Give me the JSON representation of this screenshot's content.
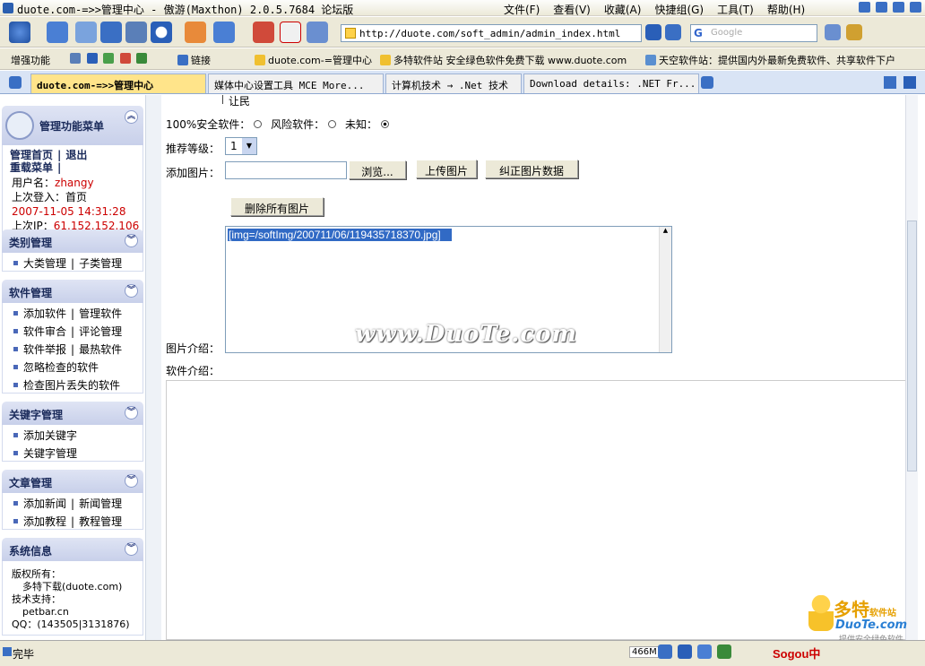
{
  "window": {
    "title": "duote.com-=>>管理中心 - 傲游(Maxthon) 2.0.5.7684 论坛版",
    "menu": [
      "文件(F)",
      "查看(V)",
      "收藏(A)",
      "快捷组(G)",
      "工具(T)",
      "帮助(H)"
    ]
  },
  "toolbar": {
    "address": "http://duote.com/soft_admin/admin_index.html",
    "search_placeholder": "Google"
  },
  "linkbar": {
    "items": [
      "增强功能",
      "链接",
      "duote.com-=管理中心",
      "多特软件站 安全绿色软件免费下载 www.duote.com",
      "天空软件站：提供国内外最新免费软件、共享软件下户"
    ]
  },
  "tabs": [
    "duote.com-=>>管理中心",
    "媒体中心设置工具 MCE More...",
    "计算机技术 → .Net 技术",
    "Download details: .NET Fr..."
  ],
  "sidebar": {
    "main": {
      "title": "管理功能菜单",
      "home": "管理首页",
      "logout": "退出",
      "reload": "重载菜单",
      "username_label": "用户名：",
      "username": "zhangy",
      "last_login_label": "上次登入：",
      "last_login_page": "首页",
      "last_login_time": "2007-11-05 14:31:28",
      "last_ip_label": "上次IP：",
      "last_ip": "61.152.152.106"
    },
    "category": {
      "title": "类别管理",
      "a": "大类管理",
      "b": "子类管理"
    },
    "software": {
      "title": "软件管理",
      "add": "添加软件",
      "manage": "管理软件",
      "review": "软件审合",
      "comments": "评论管理",
      "report": "软件举报",
      "hot": "最热软件",
      "ignored": "忽略检查的软件",
      "missing_pics": "检查图片丢失的软件"
    },
    "keywords": {
      "title": "关键字管理",
      "add": "添加关键字",
      "manage": "关键字管理"
    },
    "articles": {
      "title": "文章管理",
      "add_news": "添加新闻",
      "news_manage": "新闻管理",
      "add_tutorial": "添加教程",
      "tutorial_manage": "教程管理"
    },
    "sysinfo": {
      "title": "系统信息",
      "copyright_label": "版权所有：",
      "copyright": "多特下载(duote.com)",
      "support_label": "技术支持：",
      "support": "petbar.cn",
      "qq": "QQ：(143505|3131876)"
    }
  },
  "form": {
    "top_text": "让民",
    "safety_label": "100%安全软件：",
    "risk_label": "风险软件：",
    "unknown_label": "未知：",
    "safety_selected": "unknown",
    "rating_label": "推荐等级：",
    "rating_value": "1",
    "add_picture_label": "添加图片：",
    "browse_button": "浏览...",
    "upload_button": "上传图片",
    "fix_button": "纠正图片数据",
    "delete_all_button": "删除所有图片",
    "picture_text": "[img=/softImg/200711/06/119435718370.jpg]",
    "picture_intro_label": "图片介绍：",
    "software_intro_label": "软件介绍："
  },
  "watermark": "www.DuoTe.com",
  "status": {
    "text": "完毕",
    "memory": "466M",
    "ime": "Sogou中",
    "brand1": "多特",
    "brand1_suffix": "软件站",
    "brand2": "DuoTe.com",
    "brand3": "提供安全绿色软件"
  }
}
